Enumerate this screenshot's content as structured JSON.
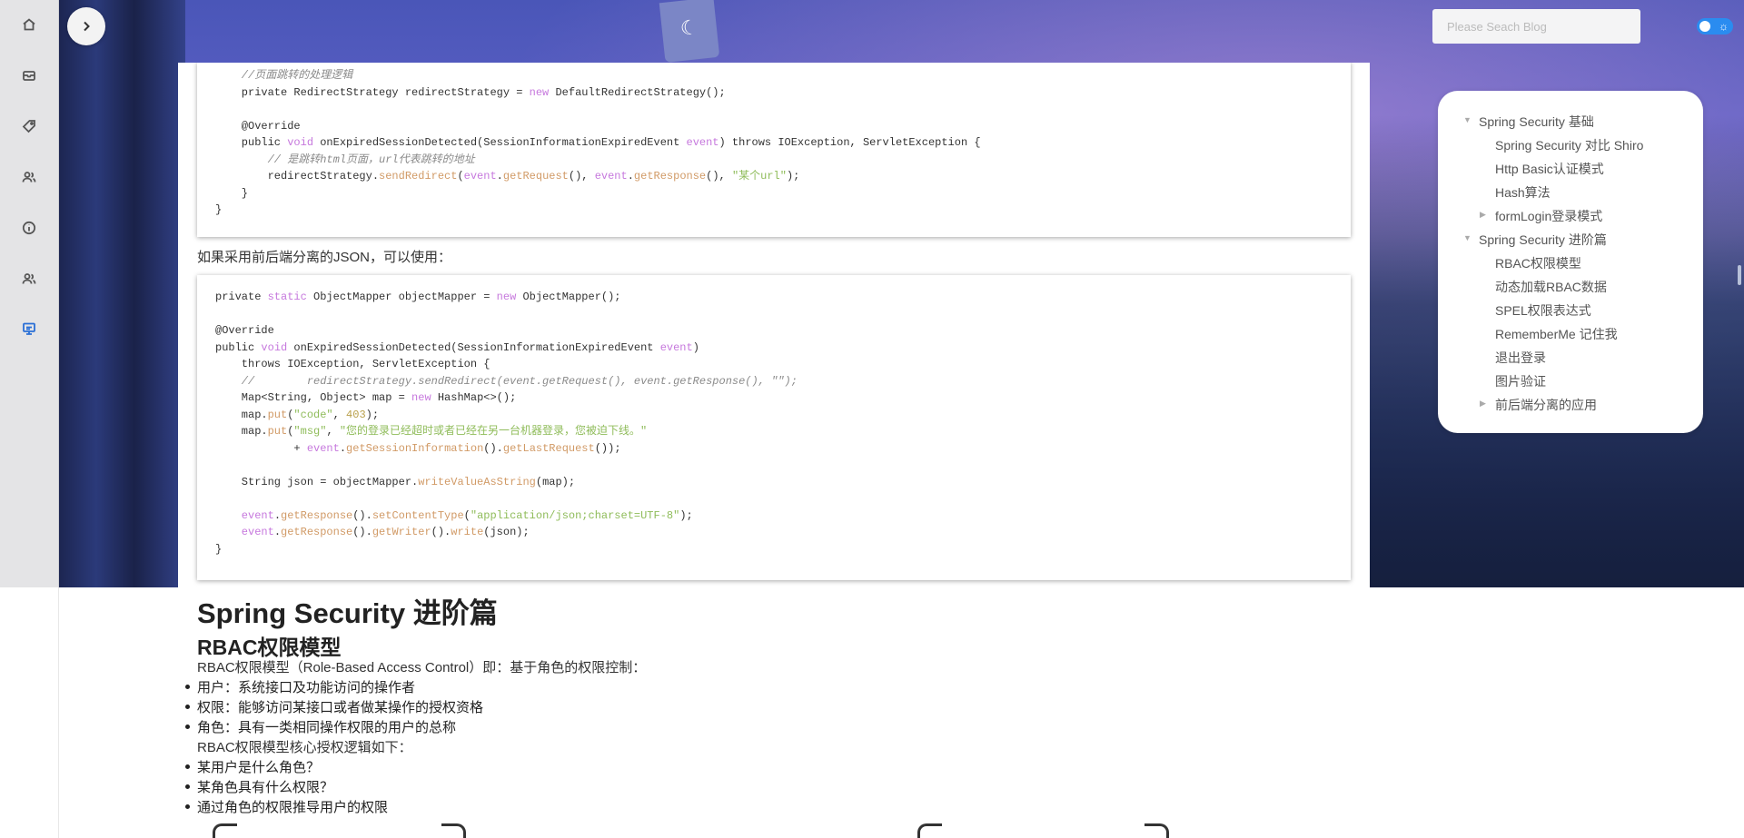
{
  "search": {
    "placeholder": "Please Seach Blog"
  },
  "sidebar": {
    "items": [
      {
        "name": "home-icon"
      },
      {
        "name": "archive-icon"
      },
      {
        "name": "tag-icon"
      },
      {
        "name": "users-icon"
      },
      {
        "name": "info-icon"
      },
      {
        "name": "friends-icon"
      },
      {
        "name": "monitor-icon"
      }
    ],
    "active_index": 6
  },
  "code_block_1": {
    "lines": [
      [
        [
          "c-cm",
          "    //页面跳转的处理逻辑"
        ]
      ],
      [
        [
          "",
          "    private RedirectStrategy redirectStrategy = "
        ],
        [
          "c-kw",
          "new"
        ],
        [
          "",
          " DefaultRedirectStrategy();"
        ]
      ],
      [
        [
          "",
          ""
        ]
      ],
      [
        [
          "",
          "    @Override"
        ]
      ],
      [
        [
          "",
          "    public "
        ],
        [
          "c-kw",
          "void"
        ],
        [
          "",
          " onExpiredSessionDetected(SessionInformationExpiredEvent "
        ],
        [
          "c-kw",
          "event"
        ],
        [
          "",
          ") throws IOException, ServletException {"
        ]
      ],
      [
        [
          "c-cm",
          "        // 是跳转html页面，url代表跳转的地址"
        ]
      ],
      [
        [
          "",
          "        redirectStrategy."
        ],
        [
          "c-fn",
          "sendRedirect"
        ],
        [
          "",
          "("
        ],
        [
          "c-kw",
          "event"
        ],
        [
          "",
          "."
        ],
        [
          "c-fn",
          "getRequest"
        ],
        [
          "",
          "(), "
        ],
        [
          "c-kw",
          "event"
        ],
        [
          "",
          "."
        ],
        [
          "c-fn",
          "getResponse"
        ],
        [
          "",
          "(), "
        ],
        [
          "c-str",
          "\"某个url\""
        ],
        [
          "",
          ");"
        ]
      ],
      [
        [
          "",
          "    }"
        ]
      ],
      [
        [
          "",
          "}"
        ]
      ]
    ]
  },
  "para_json": "如果采用前后端分离的JSON，可以使用：",
  "code_block_2": {
    "lines": [
      [
        [
          "",
          "private "
        ],
        [
          "c-kw",
          "static"
        ],
        [
          "",
          " ObjectMapper objectMapper = "
        ],
        [
          "c-kw",
          "new"
        ],
        [
          "",
          " ObjectMapper();"
        ]
      ],
      [
        [
          "",
          ""
        ]
      ],
      [
        [
          "",
          "@Override"
        ]
      ],
      [
        [
          "",
          "public "
        ],
        [
          "c-kw",
          "void"
        ],
        [
          "",
          " onExpiredSessionDetected(SessionInformationExpiredEvent "
        ],
        [
          "c-kw",
          "event"
        ],
        [
          "",
          ")"
        ]
      ],
      [
        [
          "",
          "    throws IOException, ServletException {"
        ]
      ],
      [
        [
          "c-cm",
          "    //        redirectStrategy.sendRedirect(event.getRequest(), event.getResponse(), \"\");"
        ]
      ],
      [
        [
          "",
          "    Map<String, Object> map = "
        ],
        [
          "c-kw",
          "new"
        ],
        [
          "",
          " HashMap<>();"
        ]
      ],
      [
        [
          "",
          "    map."
        ],
        [
          "c-fn",
          "put"
        ],
        [
          "",
          "("
        ],
        [
          "c-str",
          "\"code\""
        ],
        [
          "",
          ", "
        ],
        [
          "c-num",
          "403"
        ],
        [
          "",
          ");"
        ]
      ],
      [
        [
          "",
          "    map."
        ],
        [
          "c-fn",
          "put"
        ],
        [
          "",
          "("
        ],
        [
          "c-str",
          "\"msg\""
        ],
        [
          "",
          ", "
        ],
        [
          "c-str",
          "\"您的登录已经超时或者已经在另一台机器登录，您被迫下线。\""
        ]
      ],
      [
        [
          "",
          "            + "
        ],
        [
          "c-kw",
          "event"
        ],
        [
          "",
          "."
        ],
        [
          "c-fn",
          "getSessionInformation"
        ],
        [
          "",
          "()."
        ],
        [
          "c-fn",
          "getLastRequest"
        ],
        [
          "",
          "());"
        ]
      ],
      [
        [
          "",
          ""
        ]
      ],
      [
        [
          "",
          "    String json = objectMapper."
        ],
        [
          "c-fn",
          "writeValueAsString"
        ],
        [
          "",
          "(map);"
        ]
      ],
      [
        [
          "",
          ""
        ]
      ],
      [
        [
          "c-kw",
          "    event"
        ],
        [
          "",
          "."
        ],
        [
          "c-fn",
          "getResponse"
        ],
        [
          "",
          "()."
        ],
        [
          "c-fn",
          "setContentType"
        ],
        [
          "",
          "("
        ],
        [
          "c-str",
          "\"application/json;charset=UTF-8\""
        ],
        [
          "",
          ");"
        ]
      ],
      [
        [
          "c-kw",
          "    event"
        ],
        [
          "",
          "."
        ],
        [
          "c-fn",
          "getResponse"
        ],
        [
          "",
          "()."
        ],
        [
          "c-fn",
          "getWriter"
        ],
        [
          "",
          "()."
        ],
        [
          "c-fn",
          "write"
        ],
        [
          "",
          "(json);"
        ]
      ],
      [
        [
          "",
          "}"
        ]
      ]
    ]
  },
  "section": {
    "h1": "Spring Security 进阶篇",
    "h2": "RBAC权限模型",
    "intro": "RBAC权限模型（Role-Based Access Control）即：基于角色的权限控制：",
    "bullets_1": [
      "用户：系统接口及功能访问的操作者",
      "权限：能够访问某接口或者做某操作的授权资格",
      "角色：具有一类相同操作权限的用户的总称"
    ],
    "core_logic": "RBAC权限模型核心授权逻辑如下：",
    "bullets_2": [
      "某用户是什么角色？",
      "某角色具有什么权限？",
      "通过角色的权限推导用户的权限"
    ]
  },
  "toc": {
    "items": [
      {
        "label": "Spring Security 基础",
        "level": 0,
        "arrow": "▼"
      },
      {
        "label": "Spring Security 对比 Shiro",
        "level": 1,
        "arrow": ""
      },
      {
        "label": "Http Basic认证模式",
        "level": 1,
        "arrow": ""
      },
      {
        "label": "Hash算法",
        "level": 1,
        "arrow": ""
      },
      {
        "label": "formLogin登录模式",
        "level": 1,
        "arrow": "▶"
      },
      {
        "label": "Spring Security 进阶篇",
        "level": 0,
        "arrow": "▼"
      },
      {
        "label": "RBAC权限模型",
        "level": 1,
        "arrow": ""
      },
      {
        "label": "动态加载RBAC数据",
        "level": 1,
        "arrow": ""
      },
      {
        "label": "SPEL权限表达式",
        "level": 1,
        "arrow": ""
      },
      {
        "label": "RememberMe 记住我",
        "level": 1,
        "arrow": ""
      },
      {
        "label": "退出登录",
        "level": 1,
        "arrow": ""
      },
      {
        "label": "图片验证",
        "level": 1,
        "arrow": ""
      },
      {
        "label": "前后端分离的应用",
        "level": 1,
        "arrow": "▶"
      }
    ]
  },
  "colors": {
    "accent": "#2a8cf0",
    "active_icon": "#2a6fd6"
  }
}
